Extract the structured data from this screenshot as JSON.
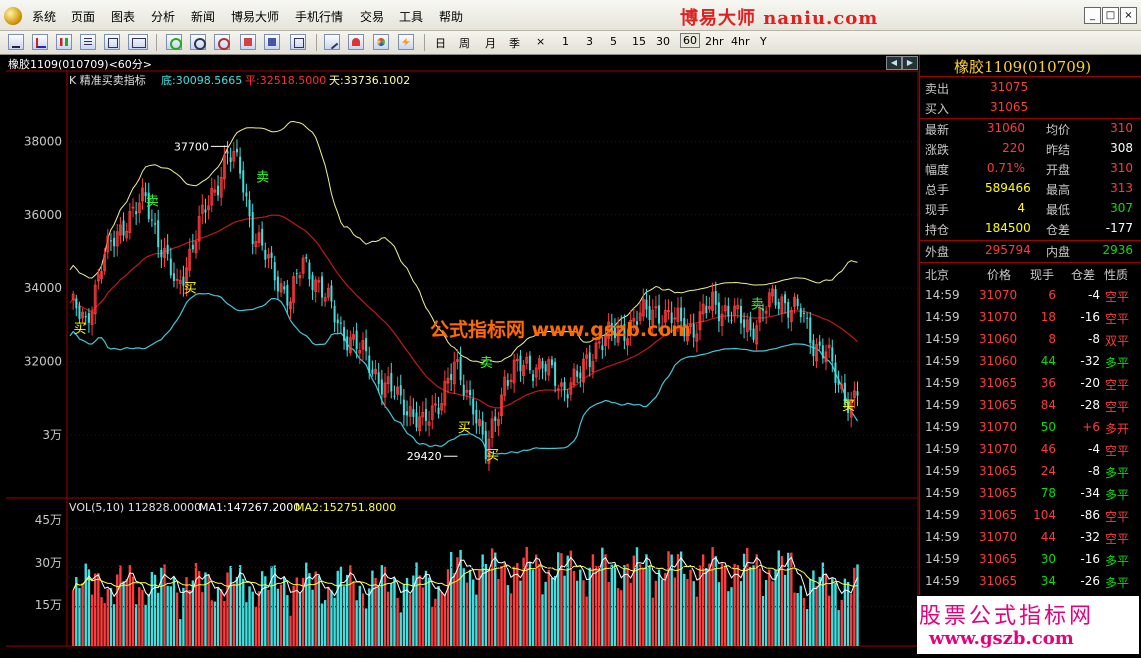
{
  "menu": [
    "系统",
    "页面",
    "图表",
    "分析",
    "新闻",
    "博易大师",
    "手机行情",
    "交易",
    "工具",
    "帮助"
  ],
  "brand": "博易大师 naniu.com",
  "window_buttons": [
    "_",
    "□",
    "×"
  ],
  "toolbar": {
    "icons": [
      "zoom-out-icon",
      "line-chart-icon",
      "kline-icon",
      "quote-list-icon",
      "layout-icon",
      "f10-icon",
      "refresh-icon",
      "find-icon",
      "draw-icon",
      "export-icon",
      "window-icon",
      "pen-icon",
      "alarm-icon",
      "palette-icon",
      "lightning-icon"
    ],
    "periods": [
      "日",
      "周",
      "月",
      "季",
      "×",
      "1",
      "3",
      "5",
      "15",
      "30",
      "60",
      "2hr",
      "4hr",
      "Y"
    ],
    "selected_period": "60"
  },
  "chart": {
    "title": "橡胶1109(010709)<60分>",
    "indicator_name": "K 精准买卖指标",
    "ind_bottom": "底:30098.5665",
    "ind_mid": "平:32518.5000",
    "ind_top": "天:33736.1002",
    "y_labels": [
      "38000",
      "36000",
      "34000",
      "32000",
      "3万"
    ],
    "high_label": "37700",
    "low_label": "29420",
    "buy_text": "买",
    "sell_text": "卖",
    "watermark": "公式指标网 www.gszb.com",
    "vol_line": "VOL(5,10) 112828.0000",
    "ma1": "MA1:147267.2000",
    "ma2": "MA2:152751.8000",
    "vol_labels": [
      "45万",
      "30万",
      "15万"
    ],
    "colors": {
      "up": "#ff3b3b",
      "down": "#40e0e0",
      "upper": "#f0f090",
      "middle": "#c01818",
      "lower": "#40c8d8",
      "buy": "#ffff00",
      "sell": "#30ff30"
    }
  },
  "chart_data": {
    "type": "candlestick",
    "title": "精准买卖指标",
    "y_axis_ticks": [
      30000,
      32000,
      34000,
      36000,
      38000
    ],
    "ylim": [
      28500,
      39400
    ],
    "price_anchors": [
      [
        0,
        33600
      ],
      [
        5,
        33000
      ],
      [
        10,
        34700
      ],
      [
        18,
        35900
      ],
      [
        24,
        36400
      ],
      [
        30,
        34900
      ],
      [
        34,
        33900
      ],
      [
        40,
        35500
      ],
      [
        46,
        36700
      ],
      [
        50,
        37700
      ],
      [
        54,
        37200
      ],
      [
        58,
        35600
      ],
      [
        64,
        34500
      ],
      [
        70,
        33700
      ],
      [
        74,
        34700
      ],
      [
        79,
        34100
      ],
      [
        86,
        32900
      ],
      [
        94,
        32100
      ],
      [
        100,
        31300
      ],
      [
        106,
        30900
      ],
      [
        112,
        30200
      ],
      [
        117,
        30950
      ],
      [
        122,
        31800
      ],
      [
        128,
        30900
      ],
      [
        132,
        29420
      ],
      [
        138,
        31500
      ],
      [
        144,
        31900
      ],
      [
        150,
        31900
      ],
      [
        156,
        31300
      ],
      [
        162,
        31600
      ],
      [
        168,
        32600
      ],
      [
        175,
        32800
      ],
      [
        180,
        33200
      ],
      [
        186,
        33400
      ],
      [
        192,
        33100
      ],
      [
        198,
        32900
      ],
      [
        204,
        33600
      ],
      [
        210,
        33300
      ],
      [
        216,
        32900
      ],
      [
        222,
        33600
      ],
      [
        226,
        33700
      ],
      [
        232,
        33300
      ],
      [
        236,
        32500
      ],
      [
        240,
        32300
      ],
      [
        244,
        31300
      ],
      [
        248,
        30900
      ],
      [
        250,
        31200
      ]
    ],
    "indicator_values": {
      "bottom": 30098.5665,
      "mid": 32518.5,
      "top": 33736.1002
    },
    "annotations": {
      "high": 37700,
      "low": 29420
    },
    "volume": {
      "ma1": 147267.2,
      "ma2": 152751.8,
      "last": 112828.0,
      "ticks": [
        150000,
        300000,
        450000
      ]
    }
  },
  "quote": {
    "name": "橡胶1109(010709)",
    "rows": [
      {
        "l": "卖出",
        "v": "31075",
        "vc": "red"
      },
      {
        "l": "买入",
        "v": "31065",
        "vc": "red"
      }
    ],
    "stats": [
      {
        "l": "最新",
        "v": "31060",
        "vc": "red",
        "l2": "均价",
        "v2": "310",
        "v2c": "red"
      },
      {
        "l": "涨跌",
        "v": "220",
        "vc": "red",
        "l2": "昨结",
        "v2": "308",
        "v2c": "white"
      },
      {
        "l": "幅度",
        "v": "0.71%",
        "vc": "red",
        "l2": "开盘",
        "v2": "310",
        "v2c": "red"
      },
      {
        "l": "总手",
        "v": "589466",
        "vc": "yellow",
        "l2": "最高",
        "v2": "313",
        "v2c": "red"
      },
      {
        "l": "现手",
        "v": "4",
        "vc": "yellow",
        "l2": "最低",
        "v2": "307",
        "v2c": "green"
      },
      {
        "l": "持仓",
        "v": "184500",
        "vc": "yellow",
        "l2": "仓差",
        "v2": "-177",
        "v2c": "white"
      }
    ],
    "outer": {
      "l": "外盘",
      "v": "295794",
      "vc": "red",
      "l2": "内盘",
      "v2": "2936",
      "v2c": "green"
    },
    "tick_headers": [
      "北京",
      "价格",
      "现手",
      "仓差",
      "性质"
    ],
    "ticks": [
      {
        "t": "14:59",
        "p": "31070",
        "v": "6",
        "o": "-4",
        "n": "空平"
      },
      {
        "t": "14:59",
        "p": "31070",
        "v": "18",
        "o": "-16",
        "n": "空平"
      },
      {
        "t": "14:59",
        "p": "31060",
        "v": "8",
        "o": "-8",
        "n": "双平"
      },
      {
        "t": "14:59",
        "p": "31060",
        "v": "44",
        "o": "-32",
        "n": "多平"
      },
      {
        "t": "14:59",
        "p": "31065",
        "v": "36",
        "o": "-20",
        "n": "空平"
      },
      {
        "t": "14:59",
        "p": "31065",
        "v": "84",
        "o": "-28",
        "n": "空平"
      },
      {
        "t": "14:59",
        "p": "31070",
        "v": "50",
        "o": "+6",
        "n": "多开"
      },
      {
        "t": "14:59",
        "p": "31070",
        "v": "46",
        "o": "-4",
        "n": "空平"
      },
      {
        "t": "14:59",
        "p": "31065",
        "v": "24",
        "o": "-8",
        "n": "多平"
      },
      {
        "t": "14:59",
        "p": "31065",
        "v": "78",
        "o": "-34",
        "n": "多平"
      },
      {
        "t": "14:59",
        "p": "31065",
        "v": "104",
        "o": "-86",
        "n": "空平"
      },
      {
        "t": "14:59",
        "p": "31070",
        "v": "44",
        "o": "-32",
        "n": "空平"
      },
      {
        "t": "14:59",
        "p": "31065",
        "v": "30",
        "o": "-16",
        "n": "多平"
      },
      {
        "t": "14:59",
        "p": "31065",
        "v": "34",
        "o": "-26",
        "n": "多平"
      }
    ]
  },
  "ad": {
    "line1": "股票公式指标网",
    "line2": "www.gszb.com"
  }
}
